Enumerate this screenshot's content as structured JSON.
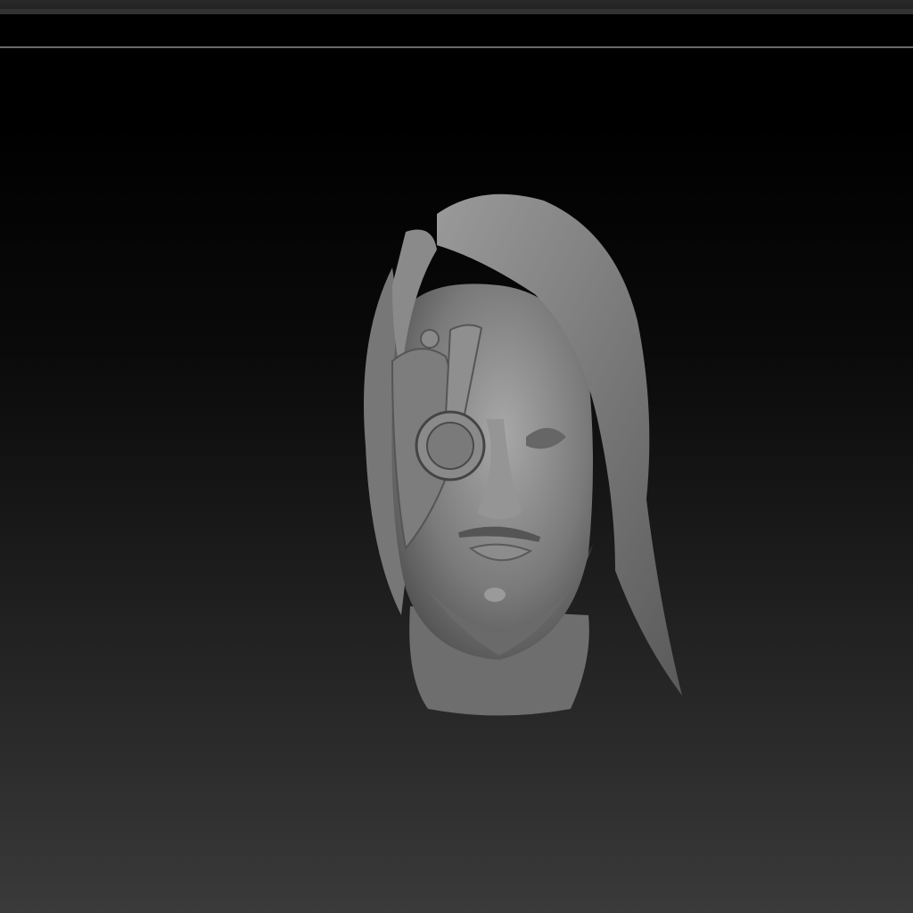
{
  "colors": {
    "viewport_top": "#000000",
    "viewport_bottom": "#3a3a3a",
    "model_base": "#8a8a8a"
  },
  "icons": {
    "model": "sculpted-head-model"
  }
}
